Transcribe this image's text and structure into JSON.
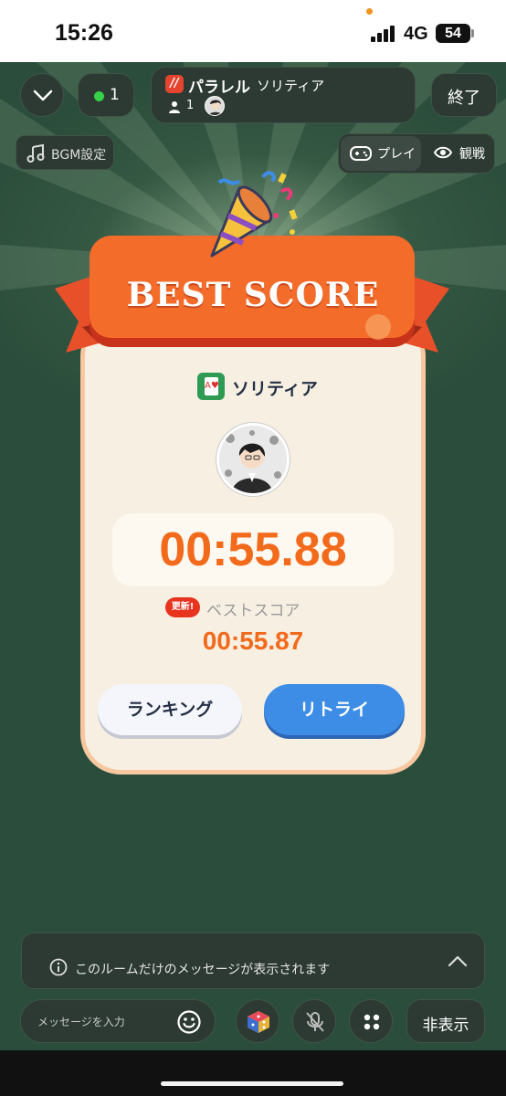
{
  "status_bar": {
    "time": "15:26",
    "network": "4G",
    "battery": "54"
  },
  "top_bar": {
    "online_count": "1",
    "brand": "パラレル",
    "game_title": "ソリティア",
    "participants": "1",
    "end_label": "終了"
  },
  "controls": {
    "bgm_label": "BGM設定",
    "play_label": "プレイ",
    "watch_label": "観戦"
  },
  "result": {
    "banner": "BEST SCORE",
    "game_name": "ソリティア",
    "time": "00:55.88",
    "new_badge": "更新!",
    "best_label": "ベストスコア",
    "best_time": "00:55.87",
    "ranking_label": "ランキング",
    "retry_label": "リトライ"
  },
  "chat": {
    "notice": "このルームだけのメッセージが表示されます",
    "input_placeholder": "メッセージを入力",
    "hide_label": "非表示"
  },
  "colors": {
    "background": "#2b4d3b",
    "accent_orange": "#f26a1b",
    "retry_blue": "#3d8de6",
    "online_green": "#37d04a",
    "new_badge_red": "#e8331f"
  }
}
